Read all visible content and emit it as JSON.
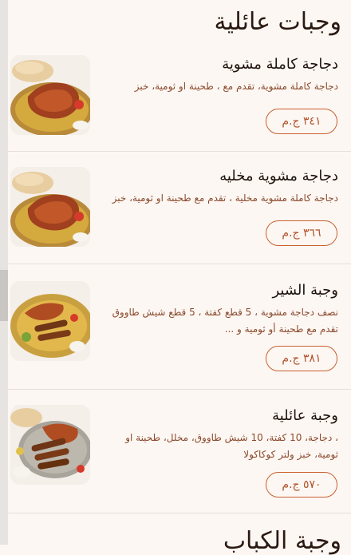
{
  "sections": [
    {
      "title": "وجبات عائلية"
    },
    {
      "title": "وجبة الكباب"
    }
  ],
  "items": [
    {
      "name": "دجاجة كاملة مشوية",
      "description": "دجاجة كاملة مشوية، تقدم مع ، طحينة او ثومية، خبز",
      "price": "٣٤١ ج.م",
      "image_icon": "grilled-chicken-rice-icon"
    },
    {
      "name": "دجاجة مشوية مخليه",
      "description": "دجاجة كاملة مشوية مخلية ، تقدم مع طحينة او ثومية، خبز",
      "price": "٣٦٦ ج.م",
      "image_icon": "grilled-chicken-rice-icon"
    },
    {
      "name": "وجبة الشير",
      "description": "نصف دجاجة مشوية ، 5 قطع كفتة ، 5 قطع شيش طاووق تقدم مع طحينة أو ثومية و ...",
      "price": "٣٨١ ج.م",
      "image_icon": "mixed-grill-platter-icon"
    },
    {
      "name": "وجبة عائلية",
      "description": "، دجاجة، 10 كفتة، 10 شيش طاووق، مخلل، طحينة او ثومية، خبز ولتر كوكاكولا",
      "price": "٥٧٠ ج.م",
      "image_icon": "family-grill-platter-icon"
    }
  ],
  "colors": {
    "background": "#fdf7f3",
    "accent": "#c9602f",
    "description_text": "#8a4a2c",
    "title_text": "#1e120c"
  }
}
